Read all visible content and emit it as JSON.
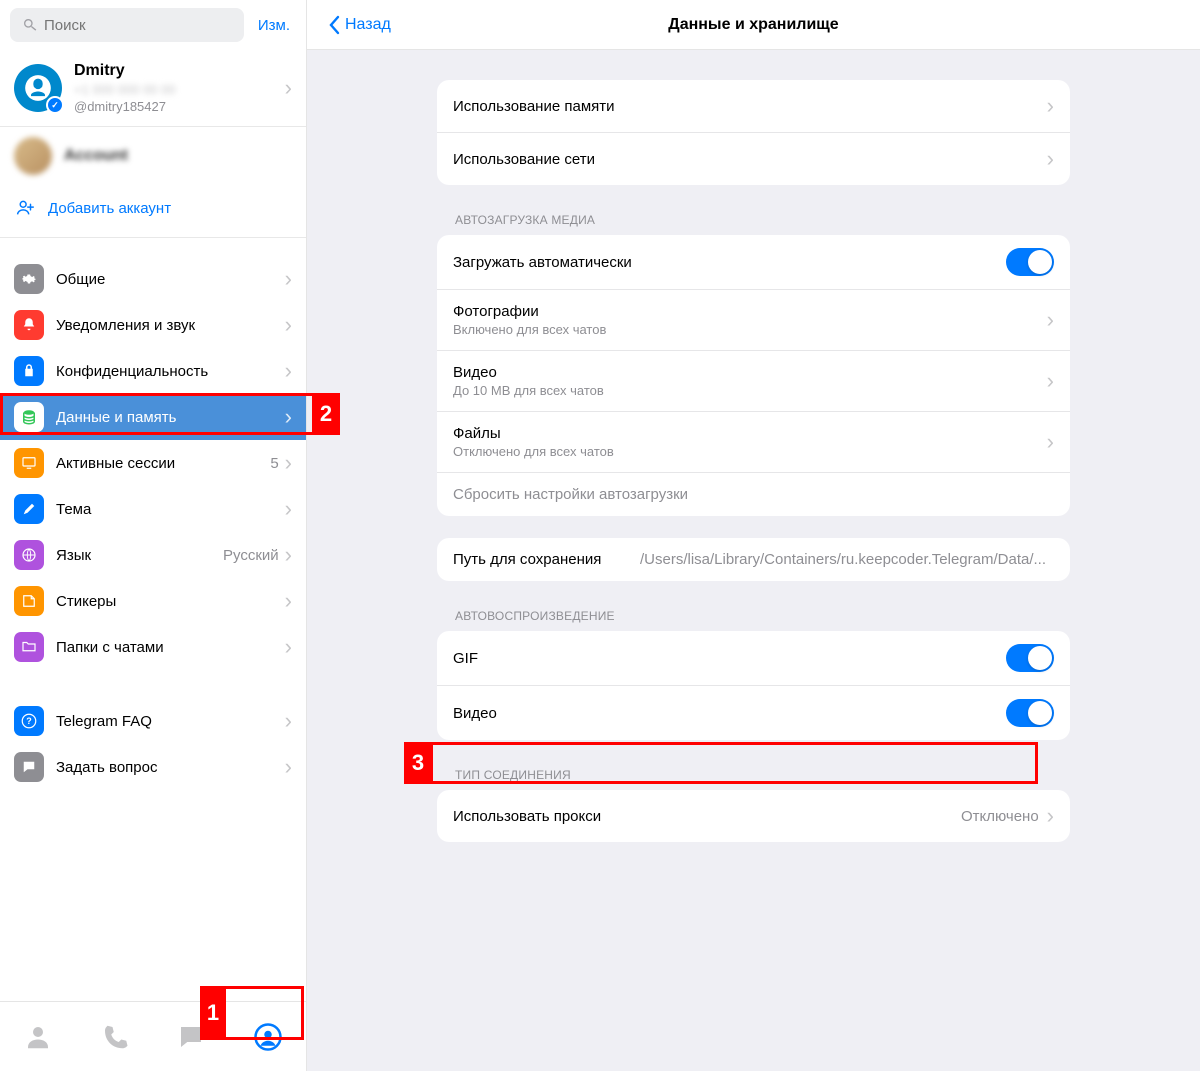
{
  "sidebar": {
    "search_placeholder": "Поиск",
    "edit_label": "Изм.",
    "profile": {
      "name": "Dmitry",
      "subtitle": "+1 000 000 00 00",
      "handle": "@dmitry185427"
    },
    "account2_name": "Account",
    "add_account_label": "Добавить аккаунт",
    "menu": {
      "general": "Общие",
      "notifications": "Уведомления и звук",
      "privacy": "Конфиденциальность",
      "data": "Данные и память",
      "sessions": "Активные сессии",
      "sessions_count": "5",
      "theme": "Тема",
      "language": "Язык",
      "language_value": "Русский",
      "stickers": "Стикеры",
      "folders": "Папки с чатами",
      "faq": "Telegram FAQ",
      "ask": "Задать вопрос"
    }
  },
  "main": {
    "back_label": "Назад",
    "title": "Данные и хранилище",
    "group1": {
      "storage": "Использование памяти",
      "network": "Использование сети"
    },
    "automedia": {
      "header": "АВТОЗАГРУЗКА МЕДИА",
      "auto_label": "Загружать автоматически",
      "photos": "Фотографии",
      "photos_sub": "Включено для всех чатов",
      "video": "Видео",
      "video_sub": "До 10 MB для всех чатов",
      "files": "Файлы",
      "files_sub": "Отключено для всех чатов",
      "reset": "Сбросить настройки автозагрузки"
    },
    "savepath": {
      "label": "Путь для сохранения",
      "value": "/Users/lisa/Library/Containers/ru.keepcoder.Telegram/Data/..."
    },
    "autoplay": {
      "header": "АВТОВОСПРОИЗВЕДЕНИЕ",
      "gif": "GIF",
      "video": "Видео"
    },
    "connection": {
      "header": "ТИП СОЕДИНЕНИЯ",
      "proxy": "Использовать прокси",
      "proxy_value": "Отключено"
    }
  },
  "annotations": {
    "a1": "1",
    "a2": "2",
    "a3": "3"
  }
}
